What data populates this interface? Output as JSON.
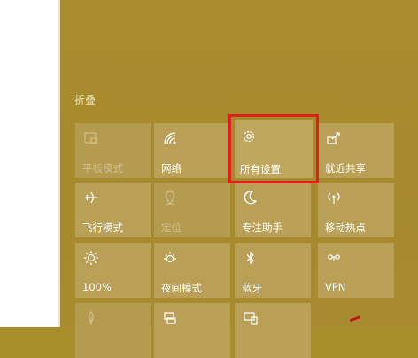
{
  "collapse_label": "折叠",
  "tiles": [
    {
      "label": "平板模式",
      "icon": "tablet-mode-icon"
    },
    {
      "label": "网络",
      "icon": "network-icon"
    },
    {
      "label": "所有设置",
      "icon": "settings-gear-icon"
    },
    {
      "label": "就近共享",
      "icon": "nearby-share-icon"
    },
    {
      "label": "飞行模式",
      "icon": "airplane-icon"
    },
    {
      "label": "定位",
      "icon": "location-icon"
    },
    {
      "label": "专注助手",
      "icon": "moon-icon"
    },
    {
      "label": "移动热点",
      "icon": "hotspot-icon"
    },
    {
      "label": "100%",
      "icon": "brightness-icon"
    },
    {
      "label": "夜间模式",
      "icon": "night-light-icon"
    },
    {
      "label": "蓝牙",
      "icon": "bluetooth-icon"
    },
    {
      "label": "VPN",
      "icon": "vpn-icon"
    },
    {
      "label": "",
      "icon": "battery-saver-icon"
    },
    {
      "label": "",
      "icon": "project-icon"
    },
    {
      "label": "",
      "icon": "connect-icon"
    }
  ],
  "colors": {
    "panel": "#a88d2d",
    "highlight": "#e0201c",
    "tile": "#b9a056"
  }
}
